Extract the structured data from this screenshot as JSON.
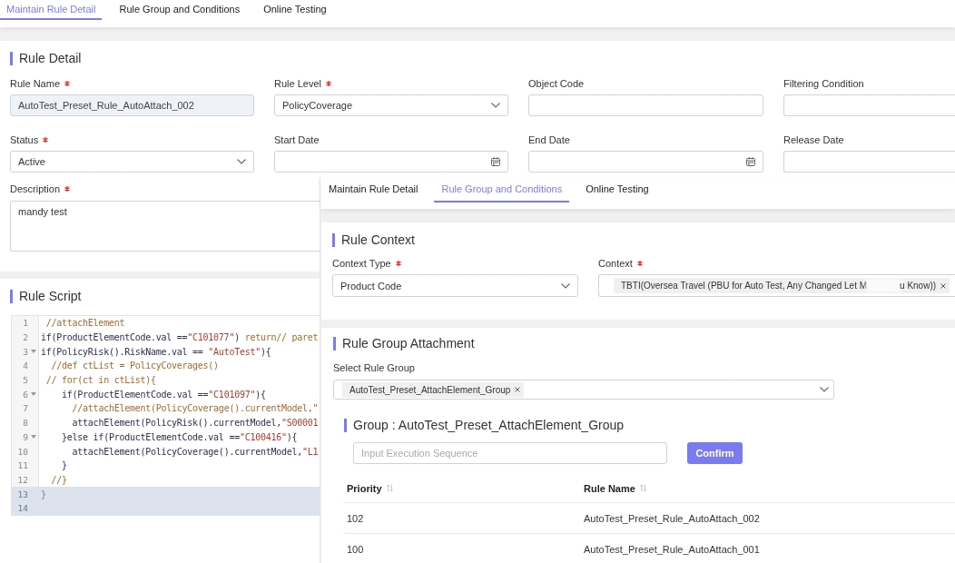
{
  "tabs": [
    {
      "label": "Maintain Rule Detail",
      "selected": true
    },
    {
      "label": "Rule Group and Conditions",
      "selected": false
    },
    {
      "label": "Online Testing",
      "selected": false
    }
  ],
  "rule_detail": {
    "title": "Rule Detail",
    "fields": [
      {
        "label": "Rule Name",
        "required": true,
        "kind": "text",
        "value": "AutoTest_Preset_Rule_AutoAttach_002",
        "disabled": true
      },
      {
        "label": "Rule Level",
        "required": true,
        "kind": "select",
        "value": "PolicyCoverage",
        "disabled": false
      },
      {
        "label": "Object Code",
        "required": false,
        "kind": "text",
        "disabled": false
      },
      {
        "label": "Filtering Condition",
        "required": false,
        "kind": "text",
        "disabled": false
      },
      {
        "label": "Status",
        "required": true,
        "kind": "select",
        "value": "Active",
        "disabled": false
      },
      {
        "label": "Start Date",
        "required": false,
        "kind": "date",
        "disabled": false
      },
      {
        "label": "End Date",
        "required": false,
        "kind": "date",
        "disabled": false
      },
      {
        "label": "Release Date",
        "required": false,
        "kind": "text",
        "disabled": false
      }
    ],
    "description": {
      "label": "Description",
      "required": true,
      "value": "mandy test"
    }
  },
  "rule_script": {
    "title": "Rule Script",
    "lines": [
      {
        "number": "1",
        "foldable": false,
        "highlighted": false,
        "segments": [
          {
            "kind": "comment",
            "text": " //attachElement"
          }
        ]
      },
      {
        "number": "2",
        "foldable": false,
        "highlighted": false,
        "segments": [
          {
            "kind": "plain",
            "text": "if(ProductElementCode.val =="
          },
          {
            "kind": "string",
            "text": "\"C101077\""
          },
          {
            "kind": "plain",
            "text": ") "
          },
          {
            "kind": "keyword",
            "text": "return"
          },
          {
            "kind": "comment",
            "text": "// paret"
          }
        ]
      },
      {
        "number": "3",
        "foldable": true,
        "highlighted": false,
        "segments": [
          {
            "kind": "plain",
            "text": "if(PolicyRisk().RiskName.val == "
          },
          {
            "kind": "string",
            "text": "\"AutoTest\""
          },
          {
            "kind": "plain",
            "text": "){"
          }
        ]
      },
      {
        "number": "4",
        "foldable": false,
        "highlighted": false,
        "segments": [
          {
            "kind": "comment",
            "text": "  //def ctList = PolicyCoverages()"
          }
        ]
      },
      {
        "number": "5",
        "foldable": false,
        "highlighted": false,
        "segments": [
          {
            "kind": "comment",
            "text": " // for(ct in ctList){"
          }
        ]
      },
      {
        "number": "6",
        "foldable": true,
        "highlighted": false,
        "segments": [
          {
            "kind": "plain",
            "text": "    if(ProductElementCode.val =="
          },
          {
            "kind": "string",
            "text": "\"C101097\""
          },
          {
            "kind": "plain",
            "text": "){"
          }
        ]
      },
      {
        "number": "7",
        "foldable": false,
        "highlighted": false,
        "segments": [
          {
            "kind": "comment",
            "text": "      //attachElement(PolicyCoverage().currentModel,\""
          }
        ]
      },
      {
        "number": "8",
        "foldable": false,
        "highlighted": false,
        "segments": [
          {
            "kind": "plain",
            "text": "      attachElement(PolicyRisk().currentModel,"
          },
          {
            "kind": "string",
            "text": "\"S00001"
          }
        ]
      },
      {
        "number": "9",
        "foldable": true,
        "highlighted": false,
        "segments": [
          {
            "kind": "plain",
            "text": "    }else if(ProductElementCode.val =="
          },
          {
            "kind": "string",
            "text": "\"C100416\""
          },
          {
            "kind": "plain",
            "text": "){"
          }
        ]
      },
      {
        "number": "10",
        "foldable": false,
        "highlighted": false,
        "segments": [
          {
            "kind": "plain",
            "text": "      attachElement(PolicyCoverage().currentModel,"
          },
          {
            "kind": "string",
            "text": "\"L1"
          }
        ]
      },
      {
        "number": "11",
        "foldable": false,
        "highlighted": false,
        "segments": [
          {
            "kind": "plain",
            "text": "    }"
          }
        ]
      },
      {
        "number": "12",
        "foldable": false,
        "highlighted": false,
        "segments": [
          {
            "kind": "comment",
            "text": "  //}"
          }
        ]
      },
      {
        "number": "13",
        "foldable": false,
        "highlighted": true,
        "segments": [
          {
            "kind": "plain",
            "text": "}"
          }
        ]
      },
      {
        "number": "14",
        "foldable": false,
        "highlighted": true
      }
    ]
  },
  "inset_window": {
    "tabs": [
      {
        "label": "Maintain Rule Detail",
        "selected": false
      },
      {
        "label": "Rule Group and Conditions",
        "selected": true
      },
      {
        "label": "Online Testing",
        "selected": false
      }
    ],
    "rule_context": {
      "title": "Rule Context",
      "context_type": {
        "label": "Context Type",
        "required": true,
        "value": "Product Code"
      },
      "context": {
        "label": "Context",
        "required": true,
        "tags": [
          {
            "visible_parts": [
              "TBTI(Oversea Travel (PBU for Auto Test, Any Changed Let M",
              "u Know))"
            ]
          }
        ]
      }
    },
    "rule_group_attachment": {
      "title": "Rule Group Attachment",
      "select": {
        "label": "Select Rule Group",
        "required": false,
        "tags": [
          "AutoTest_Preset_AttachElement_Group"
        ]
      },
      "group": {
        "title": "Group : AutoTest_Preset_AttachElement_Group",
        "sequence_input": {
          "placeholder": "Input Execution Sequence"
        },
        "confirm_button": "Confirm",
        "table": {
          "columns": [
            {
              "label": "Priority",
              "sortable": true
            },
            {
              "label": "Rule Name",
              "sortable": true
            }
          ],
          "rows": [
            [
              "102",
              "AutoTest_Preset_Rule_AutoAttach_002"
            ],
            [
              "100",
              "AutoTest_Preset_Rule_AutoAttach_001"
            ]
          ]
        }
      }
    }
  }
}
